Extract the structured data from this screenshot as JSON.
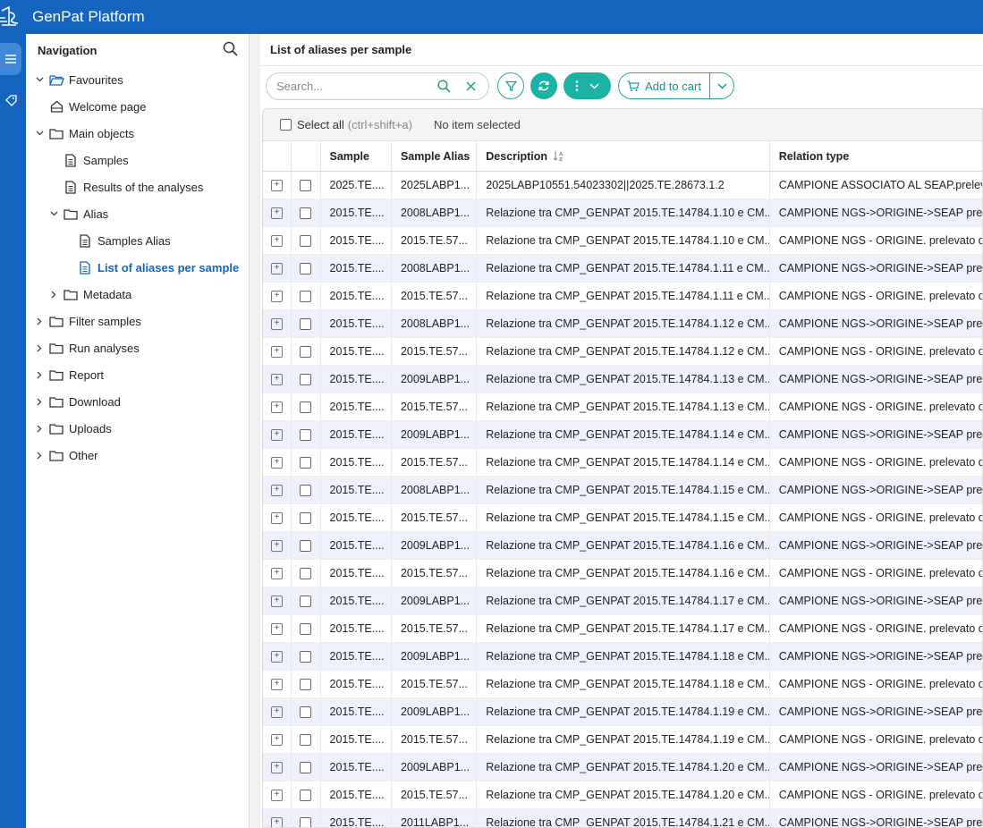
{
  "app": {
    "title": "GenPat Platform",
    "accent": "#1565c0",
    "teal": "#1db2a6"
  },
  "sidebar": {
    "title": "Navigation",
    "items": [
      {
        "label": "Favourites",
        "icon": "folder-open-icon",
        "level": 0,
        "chevron": "down",
        "active": false
      },
      {
        "label": "Welcome page",
        "icon": "home-icon",
        "level": 1,
        "chevron": "",
        "active": false
      },
      {
        "label": "Main objects",
        "icon": "folder-icon",
        "level": 0,
        "chevron": "down",
        "active": false
      },
      {
        "label": "Samples",
        "icon": "document-icon",
        "level": 2,
        "chevron": "",
        "active": false
      },
      {
        "label": "Results of the analyses",
        "icon": "document-icon",
        "level": 2,
        "chevron": "",
        "active": false
      },
      {
        "label": "Alias",
        "icon": "folder-icon",
        "level": 1,
        "chevron": "down",
        "active": false
      },
      {
        "label": "Samples Alias",
        "icon": "document-icon",
        "level": 3,
        "chevron": "",
        "active": false
      },
      {
        "label": "List of aliases per sample",
        "icon": "document-icon",
        "level": 3,
        "chevron": "",
        "active": true
      },
      {
        "label": "Metadata",
        "icon": "folder-icon",
        "level": 1,
        "chevron": "right",
        "active": false
      },
      {
        "label": "Filter samples",
        "icon": "folder-icon",
        "level": 0,
        "chevron": "right",
        "active": false
      },
      {
        "label": "Run analyses",
        "icon": "folder-icon",
        "level": 0,
        "chevron": "right",
        "active": false
      },
      {
        "label": "Report",
        "icon": "folder-icon",
        "level": 0,
        "chevron": "right",
        "active": false
      },
      {
        "label": "Download",
        "icon": "folder-icon",
        "level": 0,
        "chevron": "right",
        "active": false
      },
      {
        "label": "Uploads",
        "icon": "folder-icon",
        "level": 0,
        "chevron": "right",
        "active": false
      },
      {
        "label": "Other",
        "icon": "folder-icon",
        "level": 0,
        "chevron": "right",
        "active": false
      }
    ]
  },
  "main": {
    "title": "List of aliases per sample",
    "search": {
      "placeholder": "Search...",
      "value": ""
    },
    "toolbar": {
      "add_to_cart": "Add to cart"
    },
    "selection": {
      "select_all": "Select all",
      "shortcut": "(ctrl+shift+a)",
      "status": "No item selected"
    },
    "columns": {
      "sample": "Sample",
      "alias": "Sample Alias",
      "description": "Description",
      "relation": "Relation type"
    },
    "rows": [
      {
        "sample": "2025.TE....",
        "alias": "2025LABP1...",
        "description": "2025LABP10551.54023302||2025.TE.28673.1.2",
        "relation": "CAMPIONE ASSOCIATO AL SEAP.prelevato"
      },
      {
        "sample": "2015.TE....",
        "alias": "2008LABP1...",
        "description": "Relazione tra CMP_GENPAT 2015.TE.14784.1.10 e CM...",
        "relation": "CAMPIONE NGS->ORIGINE->SEAP prelev"
      },
      {
        "sample": "2015.TE....",
        "alias": "2015.TE.57...",
        "description": "Relazione tra CMP_GENPAT 2015.TE.14784.1.10 e CM...",
        "relation": "CAMPIONE NGS - ORIGINE. prelevato da S"
      },
      {
        "sample": "2015.TE....",
        "alias": "2008LABP1...",
        "description": "Relazione tra CMP_GENPAT 2015.TE.14784.1.11 e CM...",
        "relation": "CAMPIONE NGS->ORIGINE->SEAP prelev"
      },
      {
        "sample": "2015.TE....",
        "alias": "2015.TE.57...",
        "description": "Relazione tra CMP_GENPAT 2015.TE.14784.1.11 e CM...",
        "relation": "CAMPIONE NGS - ORIGINE. prelevato da S"
      },
      {
        "sample": "2015.TE....",
        "alias": "2008LABP1...",
        "description": "Relazione tra CMP_GENPAT 2015.TE.14784.1.12 e CM...",
        "relation": "CAMPIONE NGS->ORIGINE->SEAP prelev"
      },
      {
        "sample": "2015.TE....",
        "alias": "2015.TE.57...",
        "description": "Relazione tra CMP_GENPAT 2015.TE.14784.1.12 e CM...",
        "relation": "CAMPIONE NGS - ORIGINE. prelevato da S"
      },
      {
        "sample": "2015.TE....",
        "alias": "2009LABP1...",
        "description": "Relazione tra CMP_GENPAT 2015.TE.14784.1.13 e CM...",
        "relation": "CAMPIONE NGS->ORIGINE->SEAP prelev"
      },
      {
        "sample": "2015.TE....",
        "alias": "2015.TE.57...",
        "description": "Relazione tra CMP_GENPAT 2015.TE.14784.1.13 e CM...",
        "relation": "CAMPIONE NGS - ORIGINE. prelevato da S"
      },
      {
        "sample": "2015.TE....",
        "alias": "2009LABP1...",
        "description": "Relazione tra CMP_GENPAT 2015.TE.14784.1.14 e CM...",
        "relation": "CAMPIONE NGS->ORIGINE->SEAP prelev"
      },
      {
        "sample": "2015.TE....",
        "alias": "2015.TE.57...",
        "description": "Relazione tra CMP_GENPAT 2015.TE.14784.1.14 e CM...",
        "relation": "CAMPIONE NGS - ORIGINE. prelevato da S"
      },
      {
        "sample": "2015.TE....",
        "alias": "2008LABP1...",
        "description": "Relazione tra CMP_GENPAT 2015.TE.14784.1.15 e CM...",
        "relation": "CAMPIONE NGS->ORIGINE->SEAP prelev"
      },
      {
        "sample": "2015.TE....",
        "alias": "2015.TE.57...",
        "description": "Relazione tra CMP_GENPAT 2015.TE.14784.1.15 e CM...",
        "relation": "CAMPIONE NGS - ORIGINE. prelevato da S"
      },
      {
        "sample": "2015.TE....",
        "alias": "2009LABP1...",
        "description": "Relazione tra CMP_GENPAT 2015.TE.14784.1.16 e CM...",
        "relation": "CAMPIONE NGS->ORIGINE->SEAP prelev"
      },
      {
        "sample": "2015.TE....",
        "alias": "2015.TE.57...",
        "description": "Relazione tra CMP_GENPAT 2015.TE.14784.1.16 e CM...",
        "relation": "CAMPIONE NGS - ORIGINE. prelevato da S"
      },
      {
        "sample": "2015.TE....",
        "alias": "2009LABP1...",
        "description": "Relazione tra CMP_GENPAT 2015.TE.14784.1.17 e CM...",
        "relation": "CAMPIONE NGS->ORIGINE->SEAP prelev"
      },
      {
        "sample": "2015.TE....",
        "alias": "2015.TE.57...",
        "description": "Relazione tra CMP_GENPAT 2015.TE.14784.1.17 e CM...",
        "relation": "CAMPIONE NGS - ORIGINE. prelevato da S"
      },
      {
        "sample": "2015.TE....",
        "alias": "2009LABP1...",
        "description": "Relazione tra CMP_GENPAT 2015.TE.14784.1.18 e CM...",
        "relation": "CAMPIONE NGS->ORIGINE->SEAP prelev"
      },
      {
        "sample": "2015.TE....",
        "alias": "2015.TE.57...",
        "description": "Relazione tra CMP_GENPAT 2015.TE.14784.1.18 e CM...",
        "relation": "CAMPIONE NGS - ORIGINE. prelevato da S"
      },
      {
        "sample": "2015.TE....",
        "alias": "2009LABP1...",
        "description": "Relazione tra CMP_GENPAT 2015.TE.14784.1.19 e CM...",
        "relation": "CAMPIONE NGS->ORIGINE->SEAP prelev"
      },
      {
        "sample": "2015.TE....",
        "alias": "2015.TE.57...",
        "description": "Relazione tra CMP_GENPAT 2015.TE.14784.1.19 e CM...",
        "relation": "CAMPIONE NGS - ORIGINE. prelevato da S"
      },
      {
        "sample": "2015.TE....",
        "alias": "2009LABP1...",
        "description": "Relazione tra CMP_GENPAT 2015.TE.14784.1.20 e CM...",
        "relation": "CAMPIONE NGS->ORIGINE->SEAP prelev"
      },
      {
        "sample": "2015.TE....",
        "alias": "2015.TE.57...",
        "description": "Relazione tra CMP_GENPAT 2015.TE.14784.1.20 e CM...",
        "relation": "CAMPIONE NGS - ORIGINE. prelevato da S"
      },
      {
        "sample": "2015.TE....",
        "alias": "2011LABP1...",
        "description": "Relazione tra CMP_GENPAT 2015.TE.14784.1.21 e CM...",
        "relation": "CAMPIONE NGS->ORIGINE->SEAP prelev"
      }
    ]
  }
}
